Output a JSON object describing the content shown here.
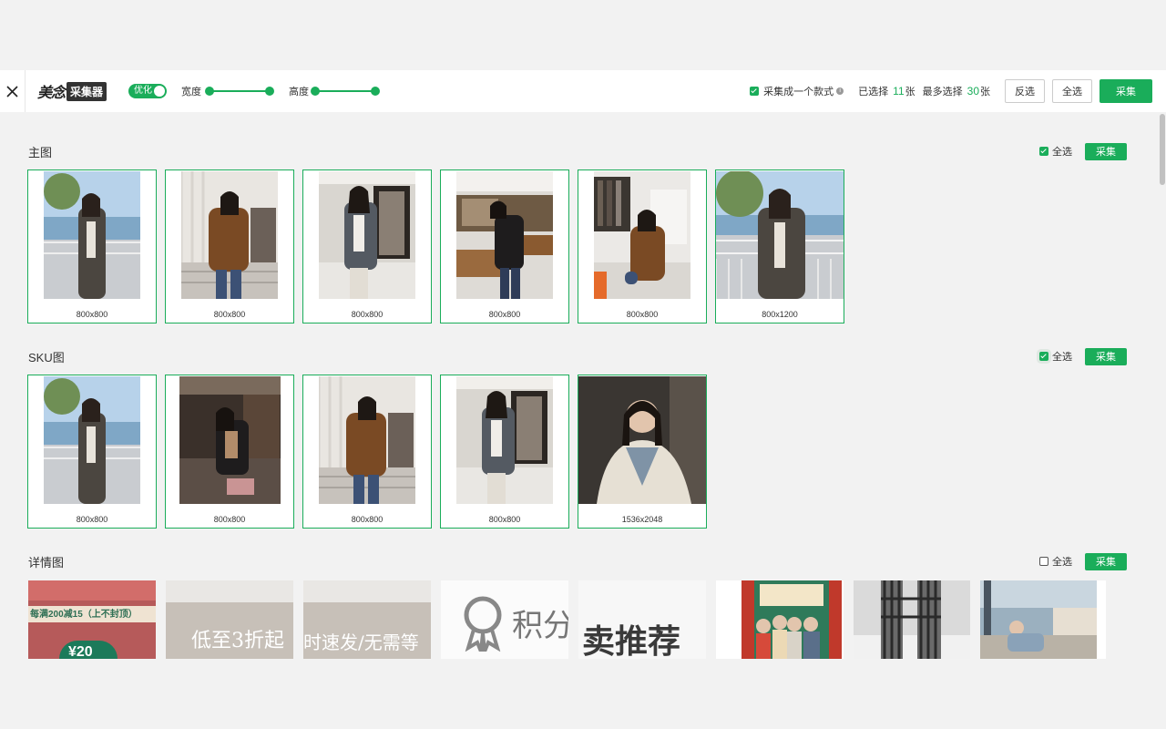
{
  "toolbar": {
    "logo_main": "美念",
    "logo_badge": "采集器",
    "optimize_label": "优化",
    "width_label": "宽度",
    "height_label": "高度",
    "collect_as_one_label": "采集成一个款式",
    "selected_prefix": "已选择",
    "selected_count": "11",
    "unit": "张",
    "max_prefix": "最多选择",
    "max_count": "30",
    "invert_label": "反选",
    "select_all_label": "全选",
    "collect_label": "采集",
    "accent_color": "#1aad5a"
  },
  "sections": {
    "main": {
      "title": "主图",
      "select_all": "全选",
      "collect": "采集",
      "checked": true,
      "images": [
        {
          "size": "800x800"
        },
        {
          "size": "800x800"
        },
        {
          "size": "800x800"
        },
        {
          "size": "800x800"
        },
        {
          "size": "800x800"
        },
        {
          "size": "800x1200"
        }
      ]
    },
    "sku": {
      "title": "SKU图",
      "select_all": "全选",
      "collect": "采集",
      "checked": true,
      "images": [
        {
          "size": "800x800"
        },
        {
          "size": "800x800"
        },
        {
          "size": "800x800"
        },
        {
          "size": "800x800"
        },
        {
          "size": "1536x2048"
        }
      ]
    },
    "detail": {
      "title": "详情图",
      "select_all": "全选",
      "collect": "采集",
      "checked": false,
      "banner1": "每满200减15（上不封顶）",
      "banner1_num": "¥20",
      "banner2": "低至3折起",
      "banner3": "时速发/无需等",
      "banner4": "积分",
      "banner5": "卖推荐"
    }
  }
}
